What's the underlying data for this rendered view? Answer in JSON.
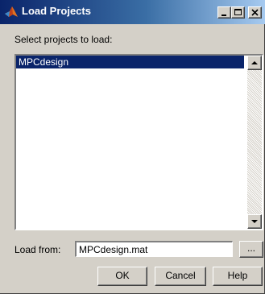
{
  "window": {
    "title": "Load Projects",
    "icon": "matlab-logo-icon",
    "caption_buttons": [
      "minimize-icon",
      "maximize-icon",
      "close-icon"
    ]
  },
  "prompt": "Select projects to load:",
  "projects": {
    "items": [
      "MPCdesign"
    ],
    "selected": "MPCdesign"
  },
  "load_from": {
    "label": "Load from:",
    "value": "MPCdesign.mat",
    "browse_label": "..."
  },
  "buttons": {
    "ok": "OK",
    "cancel": "Cancel",
    "help": "Help"
  },
  "colors": {
    "title_bar": "#0a246a",
    "selection": "#0a246a",
    "face": "#d4d0c8"
  }
}
